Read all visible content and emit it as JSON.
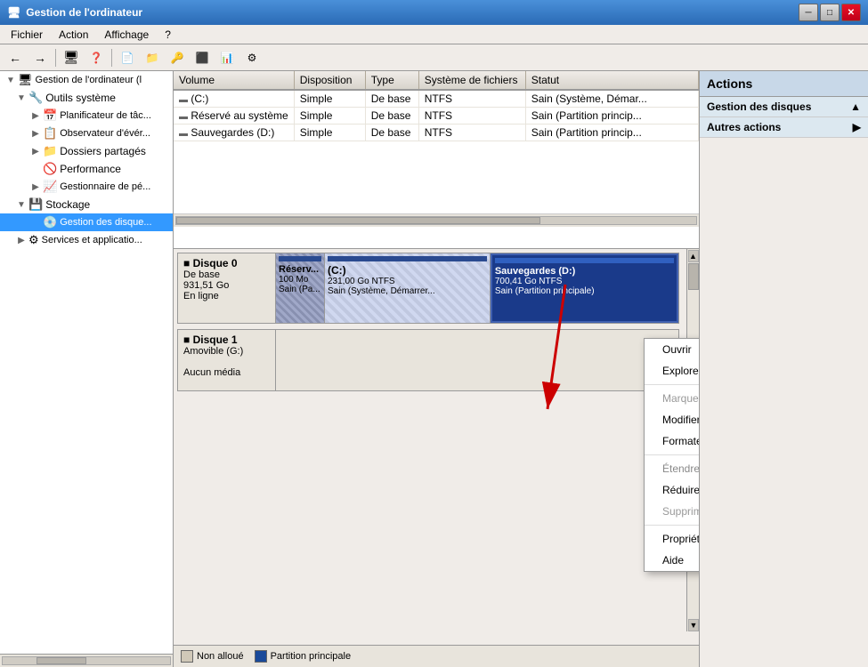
{
  "titleBar": {
    "title": "Gestion de l'ordinateur",
    "minimize": "─",
    "maximize": "□",
    "close": "✕",
    "icon": "🖥"
  },
  "menuBar": {
    "items": [
      "Fichier",
      "Action",
      "Affichage",
      "?"
    ]
  },
  "toolbar": {
    "buttons": [
      "←",
      "→",
      "⬆",
      "🖥",
      "❓",
      "📄",
      "📁",
      "🔑",
      "⬛",
      "📊",
      "⚙"
    ]
  },
  "tree": {
    "header": "Gestion de l'ordinateur (l",
    "items": [
      {
        "label": "Gestion de l'ordinateur (l",
        "level": 0,
        "expanded": true,
        "icon": "🖥"
      },
      {
        "label": "Outils système",
        "level": 1,
        "expanded": true,
        "icon": "🔧"
      },
      {
        "label": "Planificateur de tâc...",
        "level": 2,
        "expanded": false,
        "icon": "📅"
      },
      {
        "label": "Observateur d'évér...",
        "level": 2,
        "expanded": false,
        "icon": "📋"
      },
      {
        "label": "Dossiers partagés",
        "level": 2,
        "expanded": false,
        "icon": "📁"
      },
      {
        "label": "Performance",
        "level": 2,
        "expanded": false,
        "icon": "📊"
      },
      {
        "label": "Gestionnaire de pé...",
        "level": 2,
        "expanded": false,
        "icon": "📈"
      },
      {
        "label": "Stockage",
        "level": 1,
        "expanded": true,
        "icon": "💾"
      },
      {
        "label": "Gestion des disque...",
        "level": 2,
        "expanded": false,
        "icon": "💿"
      },
      {
        "label": "Services et applicatio...",
        "level": 1,
        "expanded": false,
        "icon": "⚙"
      }
    ]
  },
  "table": {
    "columns": [
      "Volume",
      "Disposition",
      "Type",
      "Système de fichiers",
      "Statut"
    ],
    "rows": [
      {
        "volume": "(C:)",
        "disposition": "Simple",
        "type": "De base",
        "fs": "NTFS",
        "statut": "Sain (Système, Démar...",
        "icon": "💾"
      },
      {
        "volume": "Réservé au système",
        "disposition": "Simple",
        "type": "De base",
        "fs": "NTFS",
        "statut": "Sain (Partition princip...",
        "icon": "💾"
      },
      {
        "volume": "Sauvegardes (D:)",
        "disposition": "Simple",
        "type": "De base",
        "fs": "NTFS",
        "statut": "Sain (Partition princip...",
        "icon": "💾"
      }
    ]
  },
  "diskView": {
    "disks": [
      {
        "name": "Disque 0",
        "type": "De base",
        "size": "931,51 Go",
        "status": "En ligne",
        "partitions": [
          {
            "label": "Réserv...",
            "size": "100 Mo",
            "fs": "",
            "status": "Sain (Pa...",
            "type": "reserved",
            "flex": 1
          },
          {
            "label": "(C:)",
            "size": "231,00 Go NTFS",
            "fs": "NTFS",
            "status": "Sain (Système, Démarrer...",
            "type": "system-c",
            "flex": 8
          },
          {
            "label": "Sauvegardes (D:)",
            "size": "700,41 Go NTFS",
            "fs": "NTFS",
            "status": "Sain (Partition principale)",
            "type": "sauvegardes",
            "flex": 9
          }
        ]
      },
      {
        "name": "Disque 1",
        "type": "Amovible (G:)",
        "size": "",
        "status": "Aucun média",
        "partitions": []
      }
    ]
  },
  "bottomBar": {
    "unallocated": "Non alloué",
    "primaryPartition": "Partition principale"
  },
  "actionsPanel": {
    "header": "Actions",
    "sections": [
      {
        "title": "Gestion des disques",
        "links": []
      },
      {
        "title": "Autres actions",
        "links": []
      }
    ]
  },
  "contextMenu": {
    "items": [
      {
        "label": "Ouvrir",
        "type": "normal",
        "disabled": false
      },
      {
        "label": "Explorer",
        "type": "normal",
        "disabled": false
      },
      {
        "label": "",
        "type": "separator"
      },
      {
        "label": "Marquer la partition comme active",
        "type": "normal",
        "disabled": true
      },
      {
        "label": "Modifier la lettre de lecteur et les chemins d'accès...",
        "type": "normal",
        "disabled": false
      },
      {
        "label": "Formater...",
        "type": "normal",
        "disabled": false
      },
      {
        "label": "",
        "type": "separator"
      },
      {
        "label": "Étendre le volume...",
        "type": "normal",
        "disabled": false,
        "highlighted": true
      },
      {
        "label": "Réduire le volume...",
        "type": "normal",
        "disabled": false
      },
      {
        "label": "Supprimer le volume...",
        "type": "normal",
        "disabled": true
      },
      {
        "label": "",
        "type": "separator"
      },
      {
        "label": "Propriétés",
        "type": "normal",
        "disabled": false
      },
      {
        "label": "Aide",
        "type": "normal",
        "disabled": false
      }
    ]
  }
}
